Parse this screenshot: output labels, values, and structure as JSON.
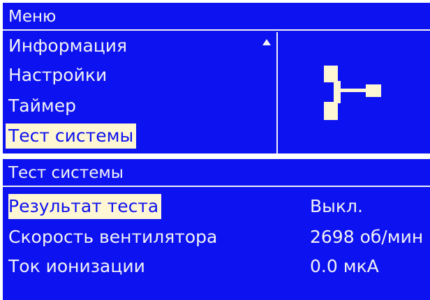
{
  "menu_screen": {
    "title": "Меню",
    "items": [
      {
        "label": "Информация"
      },
      {
        "label": "Настройки"
      },
      {
        "label": "Таймер"
      },
      {
        "label": "Тест системы",
        "selected": true
      }
    ],
    "scroll_icon": "up-triangle-icon",
    "side_icon": "fan-icon"
  },
  "test_screen": {
    "title": "Тест системы",
    "rows": [
      {
        "label": "Результат теста",
        "value": "Выкл.",
        "selected": true
      },
      {
        "label": "Скорость вентилятора",
        "value": "2698 об/мин"
      },
      {
        "label": "Ток ионизации",
        "value": "0.0 мкА"
      }
    ]
  },
  "colors": {
    "screen_background": "#0d12f0",
    "text": "#f2f2f6",
    "highlight_background": "#fff6d4",
    "highlight_text": "#0d12f0"
  }
}
